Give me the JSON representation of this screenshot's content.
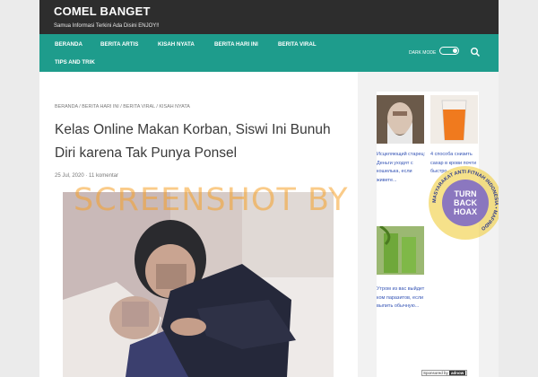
{
  "header": {
    "site_title": "COMEL BANGET",
    "tagline": "Samua Informasi Terkini Ada Disini ENJOY!!"
  },
  "nav": {
    "items": [
      "BERANDA",
      "BERITA ARTIS",
      "KISAH NYATA",
      "BERITA HARI INI",
      "BERITA VIRAL",
      "TIPS AND TRIK"
    ],
    "dark_mode_label": "DARK MODE",
    "color": "#1e9c8c"
  },
  "breadcrumb": "BERANDA / BERITA HARI INI / BERITA VIRAL / KISAH NYATA",
  "article": {
    "title": "Kelas Online Makan Korban, Siswi Ini Bunuh Diri karena Tak Punya Ponsel",
    "date": "25 Jul, 2020",
    "separator": "·",
    "comments": "11 komentar"
  },
  "sidebar": {
    "ads": [
      {
        "caption": "Исцеляющий старец: Деньги уходят с кошелька, если живете..."
      },
      {
        "caption": "4 способа снизить сахар в крови почти быстро..."
      },
      {
        "caption": "Утром из вас выйдет ком паразитов, если выпить обычную..."
      }
    ],
    "sponsored_label": "Sponsored by",
    "sponsor_name": "adnow"
  },
  "overlay": {
    "watermark": "SCREENSHOT BY",
    "badge_lines": [
      "TURN",
      "BACK",
      "HOAX"
    ],
    "badge_ring_text": "MASYARAKAT ANTI FITNAH INDONESIA • MAFINDO"
  }
}
